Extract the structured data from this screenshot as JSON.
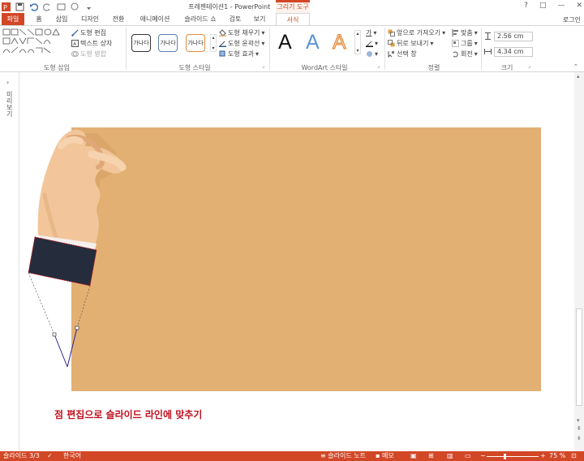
{
  "titlebar": {
    "title": "프레젠테이션1 - PowerPoint",
    "contextual_group": "그리기 도구",
    "help": "?",
    "restore": "□",
    "minimize": "—",
    "close": "✕"
  },
  "tabs": [
    "파일",
    "홈",
    "삽입",
    "디자인",
    "전환",
    "애니메이션",
    "슬라이드 쇼",
    "검토",
    "보기",
    "서식"
  ],
  "user": "로그인",
  "ribbon": {
    "insert_shapes": {
      "edit_shape": "도형 편집",
      "text_box": "텍스트 상자",
      "merge_shapes": "도형 병합",
      "label": "도형 삽입"
    },
    "shape_styles": {
      "samples": [
        "가나다",
        "가나다",
        "가나다"
      ],
      "fill": "도형 채우기",
      "outline": "도형 윤곽선",
      "effects": "도형 효과",
      "label": "도형 스타일"
    },
    "wordart": {
      "letters": [
        "A",
        "A",
        "A"
      ],
      "label": "WordArt 스타일",
      "text_fill": "가"
    },
    "arrange": {
      "bring_forward": "앞으로 가져오기",
      "send_backward": "뒤로 보내기",
      "selection_pane": "선택 창",
      "align": "맞춤",
      "group": "그룹",
      "rotate": "회전",
      "label": "정렬"
    },
    "size": {
      "height": "2.56 cm",
      "width": "4.34 cm",
      "label": "크기"
    }
  },
  "left_pane": {
    "label": "미리 보기"
  },
  "slide": {
    "caption": "점 편집으로 슬라이드 라인에 맞추기",
    "background": "#e3b074"
  },
  "status": {
    "slide_info": "슬라이드 3/3",
    "language": "한국어",
    "notes": "슬라이드 노트",
    "comments": "메모",
    "zoom": "75 %"
  },
  "colors": {
    "accent": "#d24726",
    "caption": "#c0101f",
    "sleeve": "#252d3d",
    "skin": "#f2c69a"
  }
}
